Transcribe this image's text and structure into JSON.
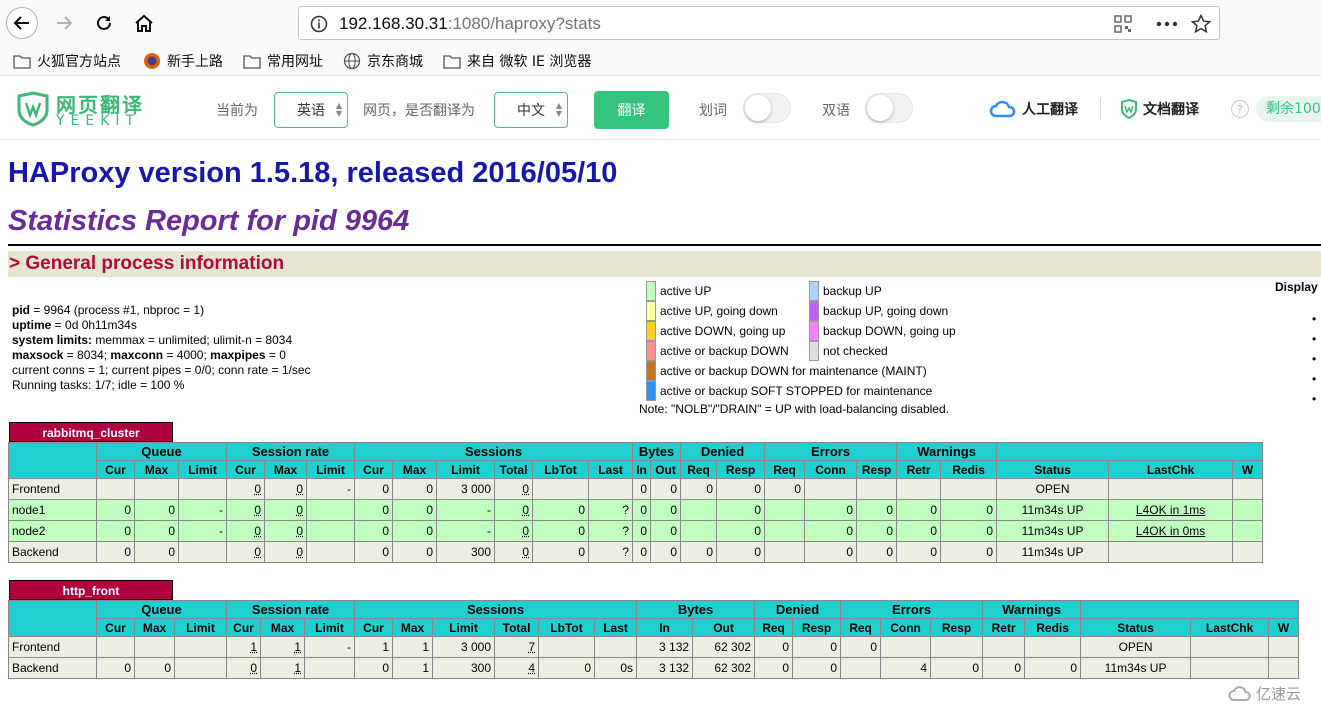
{
  "browser": {
    "url_host": "192.168.30.31",
    "url_rest": ":1080/haproxy?stats",
    "bookmarks": [
      "火狐官方站点",
      "新手上路",
      "常用网址",
      "京东商城",
      "来自 微软 IE 浏览器"
    ]
  },
  "translator": {
    "logo_cn": "网页翻译",
    "logo_en": "YEEKIT",
    "current_label": "当前为",
    "source_lang": "英语",
    "question_label": "网页，是否翻译为",
    "target_lang": "中文",
    "translate_button": "翻译",
    "word_label": "划词",
    "bilingual_label": "双语",
    "human_translate": "人工翻译",
    "doc_translate": "文档翻译",
    "help": "?",
    "remaining": "剩余100"
  },
  "page": {
    "version_title": "HAProxy version 1.5.18, released 2016/05/10",
    "report_title": "Statistics Report for pid 9964",
    "section_title": "> General process information",
    "info": {
      "pid_label": "pid",
      "pid_value": " = 9964 (process #1, nbproc = 1)",
      "uptime_label": "uptime",
      "uptime_value": " = 0d 0h11m34s",
      "limits_label": "system limits:",
      "limits_value": " memmax = unlimited; ulimit-n = 8034",
      "maxsock_label": "maxsock",
      "maxsock_value": " = 8034; ",
      "maxconn_label": "maxconn",
      "maxconn_value": " = 4000; ",
      "maxpipes_label": "maxpipes",
      "maxpipes_value": " = 0",
      "conns_line": "current conns = 1; current pipes = 0/0; conn rate = 1/sec",
      "tasks_line": "Running tasks: 1/7; idle = 100 %"
    },
    "legend_left": [
      {
        "label": "active UP",
        "color": "#c0ffc0"
      },
      {
        "label": "active UP, going down",
        "color": "#ffffa0"
      },
      {
        "label": "active DOWN, going up",
        "color": "#ffd020"
      },
      {
        "label": "active or backup DOWN",
        "color": "#ff9090"
      },
      {
        "label": "active or backup DOWN for maintenance (MAINT)",
        "color": "#c07820"
      },
      {
        "label": "active or backup SOFT STOPPED for maintenance",
        "color": "#3090f0"
      }
    ],
    "legend_right": [
      {
        "label": "backup UP",
        "color": "#b0d0ff"
      },
      {
        "label": "backup UP, going down",
        "color": "#c060ff"
      },
      {
        "label": "backup DOWN, going up",
        "color": "#ff80ff"
      },
      {
        "label": "not checked",
        "color": "#e0e0e0"
      }
    ],
    "note": "Note: \"NOLB\"/\"DRAIN\" = UP with load-balancing disabled.",
    "display_label": "Display",
    "watermark": "亿速云"
  },
  "proxies": [
    {
      "name": "rabbitmq_cluster",
      "groups": [
        "Queue",
        "Session rate",
        "Sessions",
        "Bytes",
        "Denied",
        "Errors",
        "Warnings"
      ],
      "subheaders": [
        "Cur",
        "Max",
        "Limit",
        "Cur",
        "Max",
        "Limit",
        "Cur",
        "Max",
        "Limit",
        "Total",
        "LbTot",
        "Last",
        "In",
        "Out",
        "Req",
        "Resp",
        "Req",
        "Conn",
        "Resp",
        "Retr",
        "Redis",
        "Status",
        "LastChk",
        "W"
      ],
      "rows": [
        {
          "name": "Frontend",
          "cells": [
            "",
            "",
            "",
            "0",
            "0",
            "-",
            "0",
            "0",
            "3 000",
            "0",
            "",
            "",
            "0",
            "0",
            "0",
            "0",
            "0",
            "",
            "",
            "",
            "",
            "OPEN",
            "",
            ""
          ]
        },
        {
          "name": "node1",
          "cells": [
            "0",
            "0",
            "-",
            "0",
            "0",
            "",
            "0",
            "0",
            "-",
            "0",
            "0",
            "?",
            "0",
            "0",
            "",
            "0",
            "",
            "0",
            "0",
            "0",
            "0",
            "11m34s UP",
            "L4OK in 1ms",
            ""
          ]
        },
        {
          "name": "node2",
          "cells": [
            "0",
            "0",
            "-",
            "0",
            "0",
            "",
            "0",
            "0",
            "-",
            "0",
            "0",
            "?",
            "0",
            "0",
            "",
            "0",
            "",
            "0",
            "0",
            "0",
            "0",
            "11m34s UP",
            "L4OK in 0ms",
            ""
          ]
        },
        {
          "name": "Backend",
          "cells": [
            "0",
            "0",
            "",
            "0",
            "0",
            "",
            "0",
            "0",
            "300",
            "0",
            "0",
            "?",
            "0",
            "0",
            "0",
            "0",
            "",
            "0",
            "0",
            "0",
            "0",
            "11m34s UP",
            "",
            ""
          ]
        }
      ]
    },
    {
      "name": "http_front",
      "groups": [
        "Queue",
        "Session rate",
        "Sessions",
        "Bytes",
        "Denied",
        "Errors",
        "Warnings"
      ],
      "subheaders": [
        "Cur",
        "Max",
        "Limit",
        "Cur",
        "Max",
        "Limit",
        "Cur",
        "Max",
        "Limit",
        "Total",
        "LbTot",
        "Last",
        "In",
        "Out",
        "Req",
        "Resp",
        "Req",
        "Conn",
        "Resp",
        "Retr",
        "Redis",
        "Status",
        "LastChk",
        "W"
      ],
      "rows": [
        {
          "name": "Frontend",
          "cells": [
            "",
            "",
            "",
            "1",
            "1",
            "-",
            "1",
            "1",
            "3 000",
            "7",
            "",
            "",
            "3 132",
            "62 302",
            "0",
            "0",
            "0",
            "",
            "",
            "",
            "",
            "OPEN",
            "",
            ""
          ]
        },
        {
          "name": "Backend",
          "cells": [
            "0",
            "0",
            "",
            "0",
            "1",
            "",
            "0",
            "1",
            "300",
            "4",
            "0",
            "0s",
            "3 132",
            "62 302",
            "0",
            "0",
            "",
            "4",
            "0",
            "0",
            "0",
            "11m34s UP",
            "",
            ""
          ]
        }
      ]
    }
  ]
}
